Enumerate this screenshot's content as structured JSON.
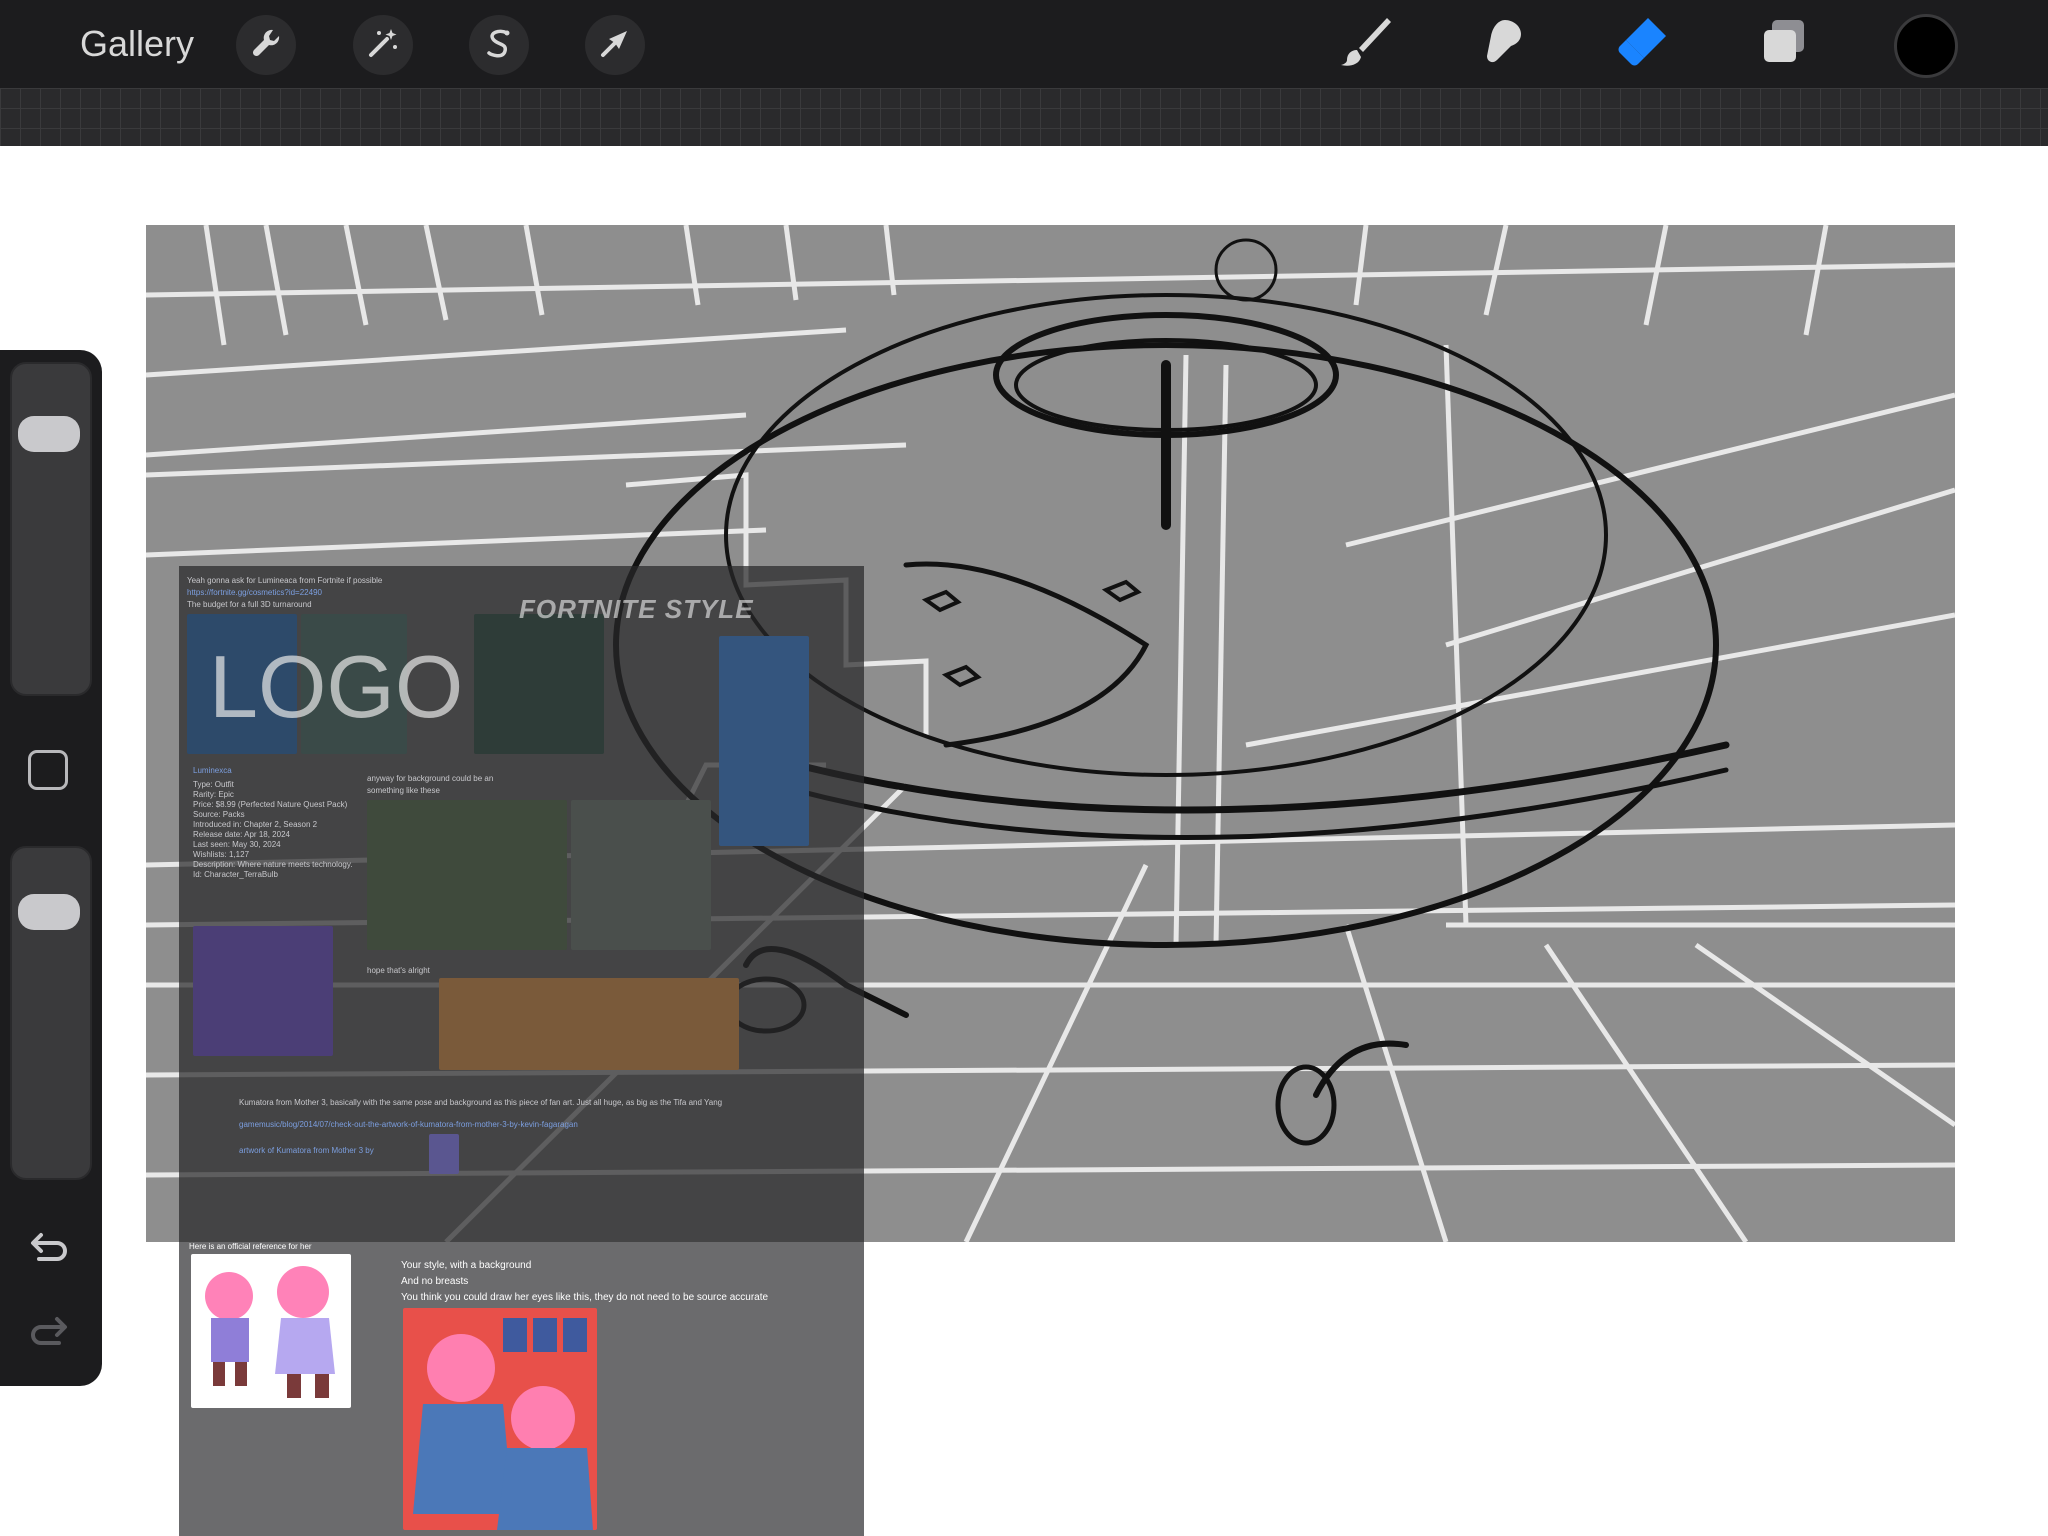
{
  "topbar": {
    "gallery_label": "Gallery",
    "left_tools": [
      {
        "name": "actions",
        "icon": "wrench-icon"
      },
      {
        "name": "adjustments",
        "icon": "magic-wand-icon"
      },
      {
        "name": "selection",
        "icon": "selection-s-icon"
      },
      {
        "name": "transform",
        "icon": "arrow-cursor-icon"
      }
    ],
    "right_tools": [
      {
        "name": "brush",
        "icon": "brush-icon",
        "active": false
      },
      {
        "name": "smudge",
        "icon": "smudge-finger-icon",
        "active": false
      },
      {
        "name": "eraser",
        "icon": "eraser-icon",
        "active": true
      },
      {
        "name": "layers",
        "icon": "layers-icon",
        "active": false
      }
    ],
    "current_color": "#000000",
    "active_color": "#1a84ff"
  },
  "sidebar": {
    "brush_size_level": 0.93,
    "opacity_level": 0.95,
    "undo_icon": "undo-arrow-icon",
    "redo_icon": "redo-arrow-icon"
  },
  "reference": {
    "overlay_heading": "FORTNITE STYLE",
    "logo_text": "LOGO",
    "msg1": "Yeah gonna ask for Lumineaca from Fortnite if possible",
    "link1": "https://fortnite.gg/cosmetics?id=22490",
    "msg2": "The budget for a full 3D turnaround",
    "card_title": "Luminexca",
    "card_lines": [
      "Type: Outfit",
      "Rarity: Epic",
      "Price: $8.99 (Perfected Nature Quest Pack)",
      "Source: Packs",
      "Introduced in: Chapter 2, Season 2",
      "Release date: Apr 18, 2024",
      "Last seen: May 30, 2024",
      "Wishlists: 1,127",
      "Description: Where nature meets technology.",
      "Id: Character_TerraBulb"
    ],
    "bg_msg": "anyway for background could be an",
    "bg_msg2": "something like these",
    "hope": "hope that's alright",
    "kumatora_msg": "Kumatora from Mother 3, basically with the same pose and background as this piece of fan art. Just all huge, as big as the Tifa and Yang",
    "kumatora_link": "gamemusic/blog/2014/07/check-out-the-artwork-of-kumatora-from-mother-3-by-kevin-fagaragan",
    "artwork_title": "artwork of Kumatora from Mother 3 by",
    "official_ref": "Here is an official reference for her",
    "style_msg1": "Your style, with a background",
    "style_msg2": "And no breasts",
    "style_msg3": "You think you could draw her eyes like this, they do not need to be source accurate"
  }
}
